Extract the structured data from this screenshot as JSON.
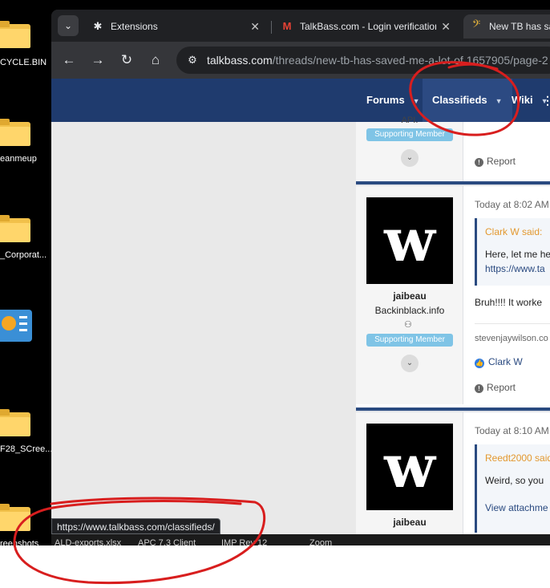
{
  "desktop": {
    "icons": [
      {
        "label": "CYCLE.BIN"
      },
      {
        "label": "eanmeup"
      },
      {
        "label": "_Corporat..."
      },
      {
        "label": ""
      },
      {
        "label": "F28_SCree..."
      },
      {
        "label": "reenshots"
      }
    ]
  },
  "browser": {
    "tabs": [
      {
        "title": "Extensions",
        "icon": "puzzle-icon"
      },
      {
        "title": "TalkBass.com - Login verification",
        "icon": "gmail-icon"
      },
      {
        "title": "New TB has saved",
        "icon": "bass-clef-icon"
      }
    ],
    "tab_close_symbol": "✕",
    "address": {
      "host": "talkbass.com",
      "path": "/threads/new-tb-has-saved-me-a-lot-of.1657905/page-2"
    },
    "status_url": "https://www.talkbass.com/classifieds/"
  },
  "site": {
    "nav": {
      "forums": "Forums",
      "classifieds": "Classifieds",
      "wiki": "Wiki",
      "more": "⋮"
    },
    "prev_post": {
      "username_fragment": "API.",
      "badge": "Supporting Member",
      "report": "Report"
    },
    "posts": [
      {
        "avatar_letter": "w",
        "username": "jaibeau",
        "user_title": "Backinblack.info",
        "badge": "Supporting Member",
        "time": "Today at 8:02 AM",
        "quote_author": "Clark W said: ",
        "quote_text": "Here, let me he",
        "quote_link": "https://www.ta",
        "text": "Bruh!!!! It worke",
        "signature": "stevenjaywilson.co",
        "reaction": "Clark W",
        "report": "Report"
      },
      {
        "avatar_letter": "w",
        "username": "jaibeau",
        "time": "Today at 8:10 AM",
        "quote_author": "Reedt2000 said",
        "quote_text": "Weird, so you",
        "quote_link": "View attachme"
      }
    ]
  },
  "taskbar": {
    "items": [
      "ALD-exports.xlsx",
      "APC 7.3 Client",
      "IMP Rev 12",
      "Zoom"
    ]
  },
  "colors": {
    "site_nav": "#1f3b6e",
    "annotation": "#d81e1e",
    "badge": "#7fc4e6",
    "quote_author": "#e3982f"
  }
}
